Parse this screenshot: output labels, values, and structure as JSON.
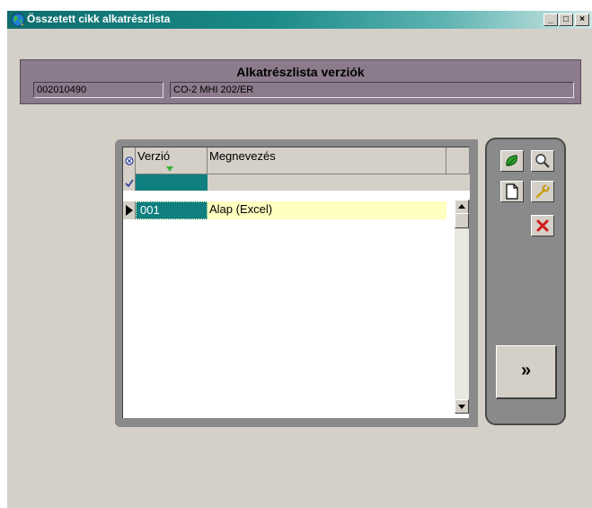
{
  "window": {
    "title": "Összetett cikk alkatrészlista",
    "minimize": "_",
    "maximize": "□",
    "close": "×"
  },
  "header": {
    "title": "Alkatrészlista verziók",
    "code": "002010490",
    "name": "CO-2 MHI 202/ER"
  },
  "grid": {
    "columns": [
      "Verzió",
      "Megnevezés"
    ],
    "rows": [
      {
        "version": "001",
        "name": "Alap (Excel)"
      }
    ]
  },
  "toolbar": {
    "next_label": "»"
  },
  "colors": {
    "title_start": "#0f6d6d",
    "panel": "#8c7b8c",
    "filter_cell": "#0f7f7f",
    "selected_row": "#ffffc0"
  }
}
